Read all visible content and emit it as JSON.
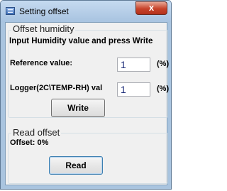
{
  "window": {
    "title": "Setting offset",
    "close_label": "x"
  },
  "offset_humidity": {
    "group_title": "Offset humidity",
    "instruction": "Input Humidity value and press Write",
    "reference_label": "Reference value:",
    "reference_value": "1",
    "reference_unit": "(%)",
    "logger_label": "Logger(2C\\TEMP-RH) val",
    "logger_value": "1",
    "logger_unit": "(%)",
    "write_label": "Write"
  },
  "read_offset": {
    "group_title": "Read offset",
    "offset_text": "Offset: 0%",
    "read_label": "Read"
  }
}
